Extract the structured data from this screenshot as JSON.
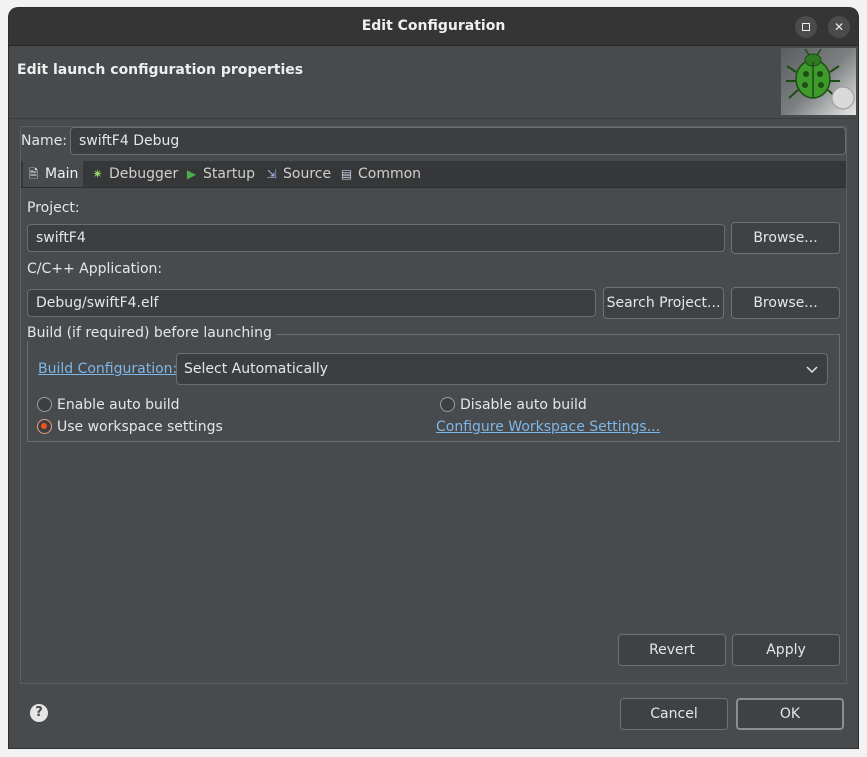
{
  "window": {
    "title": "Edit Configuration"
  },
  "header": {
    "title": "Edit launch configuration properties"
  },
  "name_field": {
    "label": "Name:",
    "value": "swiftF4 Debug"
  },
  "tabs": [
    {
      "label": "Main",
      "icon": "document-icon",
      "active": true
    },
    {
      "label": "Debugger",
      "icon": "bug-icon",
      "active": false
    },
    {
      "label": "Startup",
      "icon": "play-icon",
      "active": false
    },
    {
      "label": "Source",
      "icon": "source-icon",
      "active": false
    },
    {
      "label": "Common",
      "icon": "table-icon",
      "active": false
    }
  ],
  "project": {
    "label": "Project:",
    "value": "swiftF4",
    "browse_label": "Browse..."
  },
  "application": {
    "label": "C/C++ Application:",
    "value": "Debug/swiftF4.elf",
    "search_label": "Search Project...",
    "browse_label": "Browse..."
  },
  "build": {
    "group_label": "Build (if required) before launching",
    "config_link": "Build Configuration:",
    "config_value": "Select Automatically",
    "enable_auto": "Enable auto build",
    "disable_auto": "Disable auto build",
    "use_workspace": "Use workspace settings",
    "configure_link": "Configure Workspace Settings...",
    "selected": "use_workspace"
  },
  "panel_buttons": {
    "revert": "Revert",
    "apply": "Apply"
  },
  "dialog_buttons": {
    "cancel": "Cancel",
    "ok": "OK"
  },
  "colors": {
    "background": "#474b4d",
    "titlebar": "#353535",
    "link": "#7fb6e8",
    "radio_accent": "#e95420"
  }
}
